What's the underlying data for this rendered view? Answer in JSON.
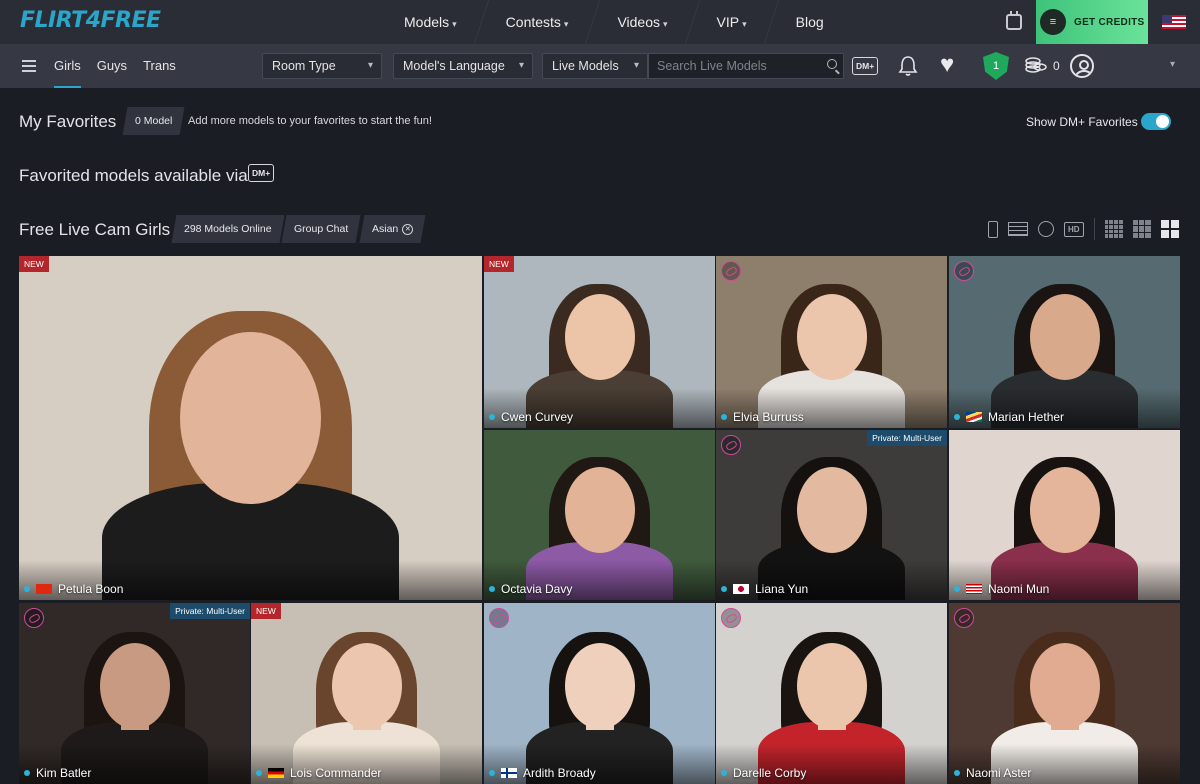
{
  "brand": {
    "logo_text": "FLIRT4FREE"
  },
  "nav": {
    "items": [
      {
        "label": "Models",
        "has_dropdown": true
      },
      {
        "label": "Contests",
        "has_dropdown": true
      },
      {
        "label": "Videos",
        "has_dropdown": true
      },
      {
        "label": "VIP",
        "has_dropdown": true
      },
      {
        "label": "Blog",
        "has_dropdown": false
      }
    ],
    "chevron": "▾",
    "get_credits": "GET CREDITS",
    "coin_icon_label": "≡",
    "credits_accent": "#3ec27a"
  },
  "subnav": {
    "tabs": [
      {
        "label": "Girls",
        "active": true
      },
      {
        "label": "Guys",
        "active": false
      },
      {
        "label": "Trans",
        "active": false
      }
    ],
    "room_type": "Room Type",
    "language": "Model's Language",
    "live_models": "Live Models",
    "search_placeholder": "Search Live Models",
    "dm_badge": "DM+",
    "shield_level": "1",
    "coin_count": "0",
    "chevron": "▾"
  },
  "favorites": {
    "title": "My Favorites",
    "count_pill": "0 Model",
    "hint": "Add more models to your favorites to start the fun!",
    "toggle_label": "Show DM+ Favorites",
    "toggle_on": true
  },
  "via": {
    "title": "Favorited models available via",
    "badge": "DM+"
  },
  "free": {
    "title": "Free Live Cam Girls",
    "pills": [
      "298 Models Online",
      "Group Chat",
      "Asian"
    ],
    "asian_remove": "✕",
    "hd_label": "HD"
  },
  "badges": {
    "new": "NEW",
    "private": "Private: Multi-User"
  },
  "models": [
    {
      "name": "Petula Boon",
      "flag": "cn",
      "badge": "new",
      "dm": false,
      "bg": "#d6cdc3",
      "skin": "#e2b59a",
      "hair": "#8b5a36",
      "top": "#1c1c1c"
    },
    {
      "name": "Cwen Curvey",
      "flag": "",
      "badge": "new",
      "dm": false,
      "bg": "#aeb7bd",
      "skin": "#ecc4a7",
      "hair": "#3b2a1f",
      "top": "#4b3f35"
    },
    {
      "name": "Elvia Burruss",
      "flag": "",
      "badge": "",
      "dm": true,
      "bg": "#8e7e6c",
      "skin": "#ecc6ac",
      "hair": "#3a2619",
      "top": "#e6e2de"
    },
    {
      "name": "Marian Hether",
      "flag": "sc",
      "badge": "",
      "dm": true,
      "bg": "#556b71",
      "skin": "#d8a98b",
      "hair": "#1a1412",
      "top": "#2a2d30"
    },
    {
      "name": "Octavia Davy",
      "flag": "",
      "badge": "",
      "dm": false,
      "bg": "#3f5a3d",
      "skin": "#e2b396",
      "hair": "#201812",
      "top": "#8d5aa6"
    },
    {
      "name": "Liana Yun",
      "flag": "jp",
      "badge": "private",
      "dm": true,
      "bg": "#3e3c3b",
      "skin": "#e3b9a0",
      "hair": "#14110f",
      "top": "#121212"
    },
    {
      "name": "Naomi Mun",
      "flag": "my",
      "badge": "",
      "dm": false,
      "bg": "#e0d6cf",
      "skin": "#e4b59b",
      "hair": "#17120f",
      "top": "#8a2f4c"
    },
    {
      "name": "Kim Batler",
      "flag": "",
      "badge": "private",
      "dm": true,
      "bg": "#312927",
      "skin": "#c99a82",
      "hair": "#1c1410",
      "top": "#1d1a19"
    },
    {
      "name": "Lois Commander",
      "flag": "de",
      "badge": "new",
      "dm": false,
      "bg": "#c7bfb4",
      "skin": "#ecc6ae",
      "hair": "#6a452d",
      "top": "#ede2d5"
    },
    {
      "name": "Ardith Broady",
      "flag": "fi",
      "badge": "",
      "dm": true,
      "bg": "#9fb4c7",
      "skin": "#efd0bd",
      "hair": "#151210",
      "top": "#222"
    },
    {
      "name": "Darelle Corby",
      "flag": "",
      "badge": "",
      "dm": true,
      "bg": "#d4d2cf",
      "skin": "#ecc6ac",
      "hair": "#1a1411",
      "top": "#c3242c"
    },
    {
      "name": "Naomi Aster",
      "flag": "",
      "badge": "",
      "dm": true,
      "bg": "#4e3a33",
      "skin": "#e0ab90",
      "hair": "#4a2c1c",
      "top": "#f1ece7"
    }
  ]
}
